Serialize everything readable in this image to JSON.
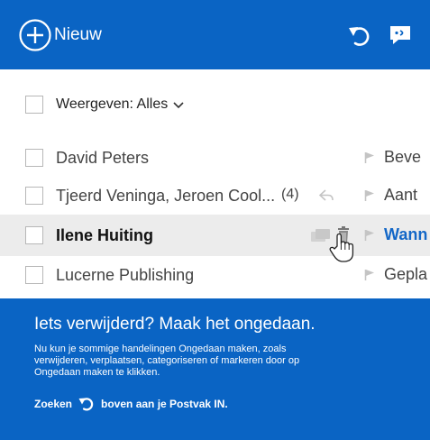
{
  "toolbar": {
    "new_label": "Nieuw",
    "icons": [
      "plus-circle-icon",
      "undo-icon",
      "chat-icon"
    ]
  },
  "filter": {
    "label": "Weergeven: Alles"
  },
  "messages": [
    {
      "sender": "David Peters",
      "count": "",
      "subject": "Beve",
      "selected": false
    },
    {
      "sender": "Tjeerd Veninga, Jeroen Cool...",
      "count": "(4)",
      "subject": "Aant",
      "selected": false
    },
    {
      "sender": "Ilene Huiting",
      "count": "",
      "subject": "Wann",
      "selected": true
    },
    {
      "sender": "Lucerne Publishing",
      "count": "",
      "subject": "Gepla",
      "selected": false
    }
  ],
  "banner": {
    "title": "Iets verwijderd? Maak het ongedaan.",
    "body": "Nu kun je sommige handelingen Ongedaan maken, zoals verwijderen, verplaatsen, categoriseren of markeren door op Ongedaan maken te klikken.",
    "search_before": "Zoeken",
    "search_after": "boven aan je Postvak IN."
  },
  "colors": {
    "brand_blue": "#0a64c4",
    "selected_row": "#ececec",
    "link_blue": "#1367c7"
  }
}
